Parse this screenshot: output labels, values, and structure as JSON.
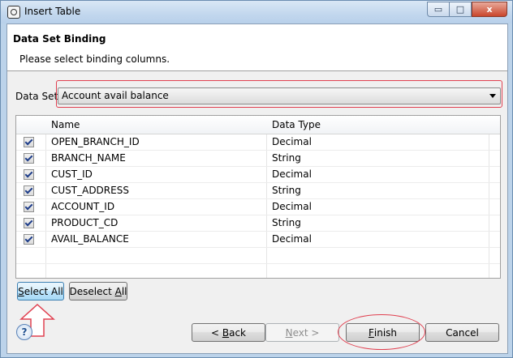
{
  "window": {
    "title": "Insert Table"
  },
  "caption": {
    "minimize": "▭",
    "maximize": "□",
    "close": "x"
  },
  "header": {
    "title": "Data Set Binding",
    "message": "Please select binding columns."
  },
  "dataset": {
    "label": "Data Set:",
    "value": "Account avail balance"
  },
  "table": {
    "columns": [
      "Name",
      "Data Type"
    ],
    "rows": [
      {
        "checked": true,
        "name": "OPEN_BRANCH_ID",
        "type": "Decimal"
      },
      {
        "checked": true,
        "name": "BRANCH_NAME",
        "type": "String"
      },
      {
        "checked": true,
        "name": "CUST_ID",
        "type": "Decimal"
      },
      {
        "checked": true,
        "name": "CUST_ADDRESS",
        "type": "String"
      },
      {
        "checked": true,
        "name": "ACCOUNT_ID",
        "type": "Decimal"
      },
      {
        "checked": true,
        "name": "PRODUCT_CD",
        "type": "String"
      },
      {
        "checked": true,
        "name": "AVAIL_BALANCE",
        "type": "Decimal"
      }
    ]
  },
  "buttons": {
    "select_all": {
      "u": "S",
      "rest": "elect All"
    },
    "deselect_all": {
      "pre": "Deselect ",
      "u": "A",
      "rest": "ll"
    },
    "back": {
      "pre": "< ",
      "u": "B",
      "rest": "ack"
    },
    "next": {
      "pre": "",
      "u": "N",
      "rest": "ext >"
    },
    "finish": {
      "u": "F",
      "rest": "inish"
    },
    "cancel": "Cancel"
  },
  "help": {
    "icon": "question-icon",
    "glyph": "?"
  },
  "annotations": {
    "highlight_color": "#e04050"
  }
}
